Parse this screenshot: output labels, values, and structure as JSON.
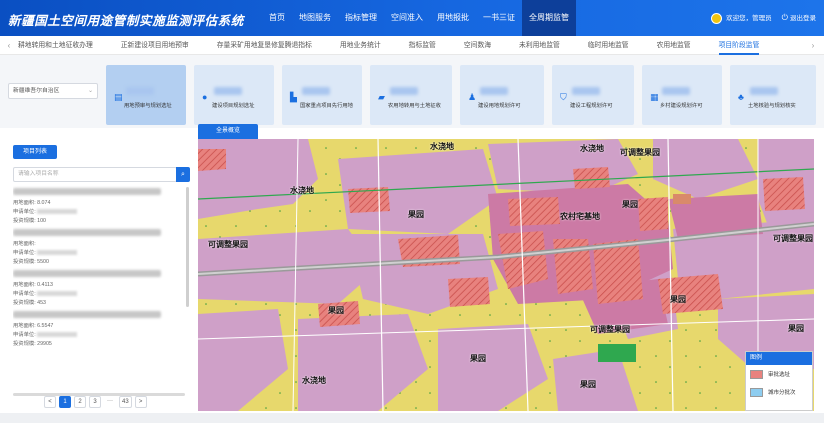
{
  "header": {
    "title": "新疆国土空间用途管制实施监测评估系统",
    "nav": [
      "首页",
      "地图服务",
      "指标管理",
      "空间准入",
      "用地报批",
      "一书三证",
      "全周期监管"
    ],
    "active_nav_index": 6,
    "user_greeting": "欢迎您，管理员",
    "logout": "退出登录"
  },
  "subtabs": {
    "items": [
      "耕地转用和土地征收办理",
      "正新建设项目用地预审",
      "存量采矿用地复垦修复腾退指标",
      "用地业务统计",
      "指标监管",
      "空间数海",
      "未利用地监管",
      "临时用地监管",
      "农用地监管",
      "项目阶段监管"
    ],
    "active_index": 9
  },
  "filter": {
    "region": "新疆维吾尔自治区",
    "categories": [
      {
        "label": "用地预审与规划选址",
        "icon": "document-icon"
      },
      {
        "label": "建设项目规划选址",
        "icon": "person-icon"
      },
      {
        "label": "国家重点项目先行用地",
        "icon": "building-icon"
      },
      {
        "label": "农用地转用与土地征收",
        "icon": "truck-icon"
      },
      {
        "label": "建设用地规划许可",
        "icon": "walker-icon"
      },
      {
        "label": "建设工程规划许可",
        "icon": "shield-icon"
      },
      {
        "label": "乡村建设规划许可",
        "icon": "clipboard-icon"
      },
      {
        "label": "土地核验与规划核实",
        "icon": "person-check-icon"
      }
    ],
    "active_index": 0
  },
  "left_panel": {
    "tab_label": "项目列表",
    "search_placeholder": "请输入项目名称",
    "projects": [
      {
        "area": "用地面积: 8.074",
        "applicant": "申请单位:",
        "investment": "投资规模: 100"
      },
      {
        "area": "用地面积:",
        "applicant": "申请单位:",
        "investment": "投资规模: 5500"
      },
      {
        "area": "用地面积: 0.4113",
        "applicant": "申请单位:",
        "investment": "投资规模: 453"
      },
      {
        "area": "用地面积: 6.5547",
        "applicant": "申请单位:",
        "investment": "投资规模: 29905"
      }
    ],
    "pagination": {
      "prev": "<",
      "pages": [
        "1",
        "2",
        "3",
        "···",
        "43"
      ],
      "active": "1",
      "next": ">"
    }
  },
  "map": {
    "tab_label": "全景概览",
    "labels": [
      {
        "text": "水浇地",
        "key": "l1"
      },
      {
        "text": "水浇地",
        "key": "l2"
      },
      {
        "text": "水浇地",
        "key": "l3"
      },
      {
        "text": "可调整果园",
        "key": "l4"
      },
      {
        "text": "果园",
        "key": "l5"
      },
      {
        "text": "农村宅基地",
        "key": "l6"
      },
      {
        "text": "果园",
        "key": "l7"
      },
      {
        "text": "可调整果园",
        "key": "l8"
      },
      {
        "text": "可调整果园",
        "key": "l9"
      },
      {
        "text": "果园",
        "key": "l10"
      },
      {
        "text": "果园",
        "key": "l11"
      },
      {
        "text": "可调整果园",
        "key": "l12"
      },
      {
        "text": "果园",
        "key": "l13"
      },
      {
        "text": "果园",
        "key": "l14"
      },
      {
        "text": "水浇地",
        "key": "l15"
      },
      {
        "text": "果园",
        "key": "l16"
      }
    ],
    "legend": {
      "title": "图例",
      "items": [
        {
          "label": "审批选址",
          "color": "#e8827e"
        },
        {
          "label": "城市分批次",
          "color": "#8ecdf0"
        }
      ]
    },
    "colors": {
      "farmland": "#e7d86c",
      "orchard": "#cfa0c8",
      "homestead": "#cc7aa5",
      "approved": "#e8827e",
      "road": "#9a9a9a",
      "water": "#2fa84f",
      "forest": "#0f8a3a"
    }
  }
}
